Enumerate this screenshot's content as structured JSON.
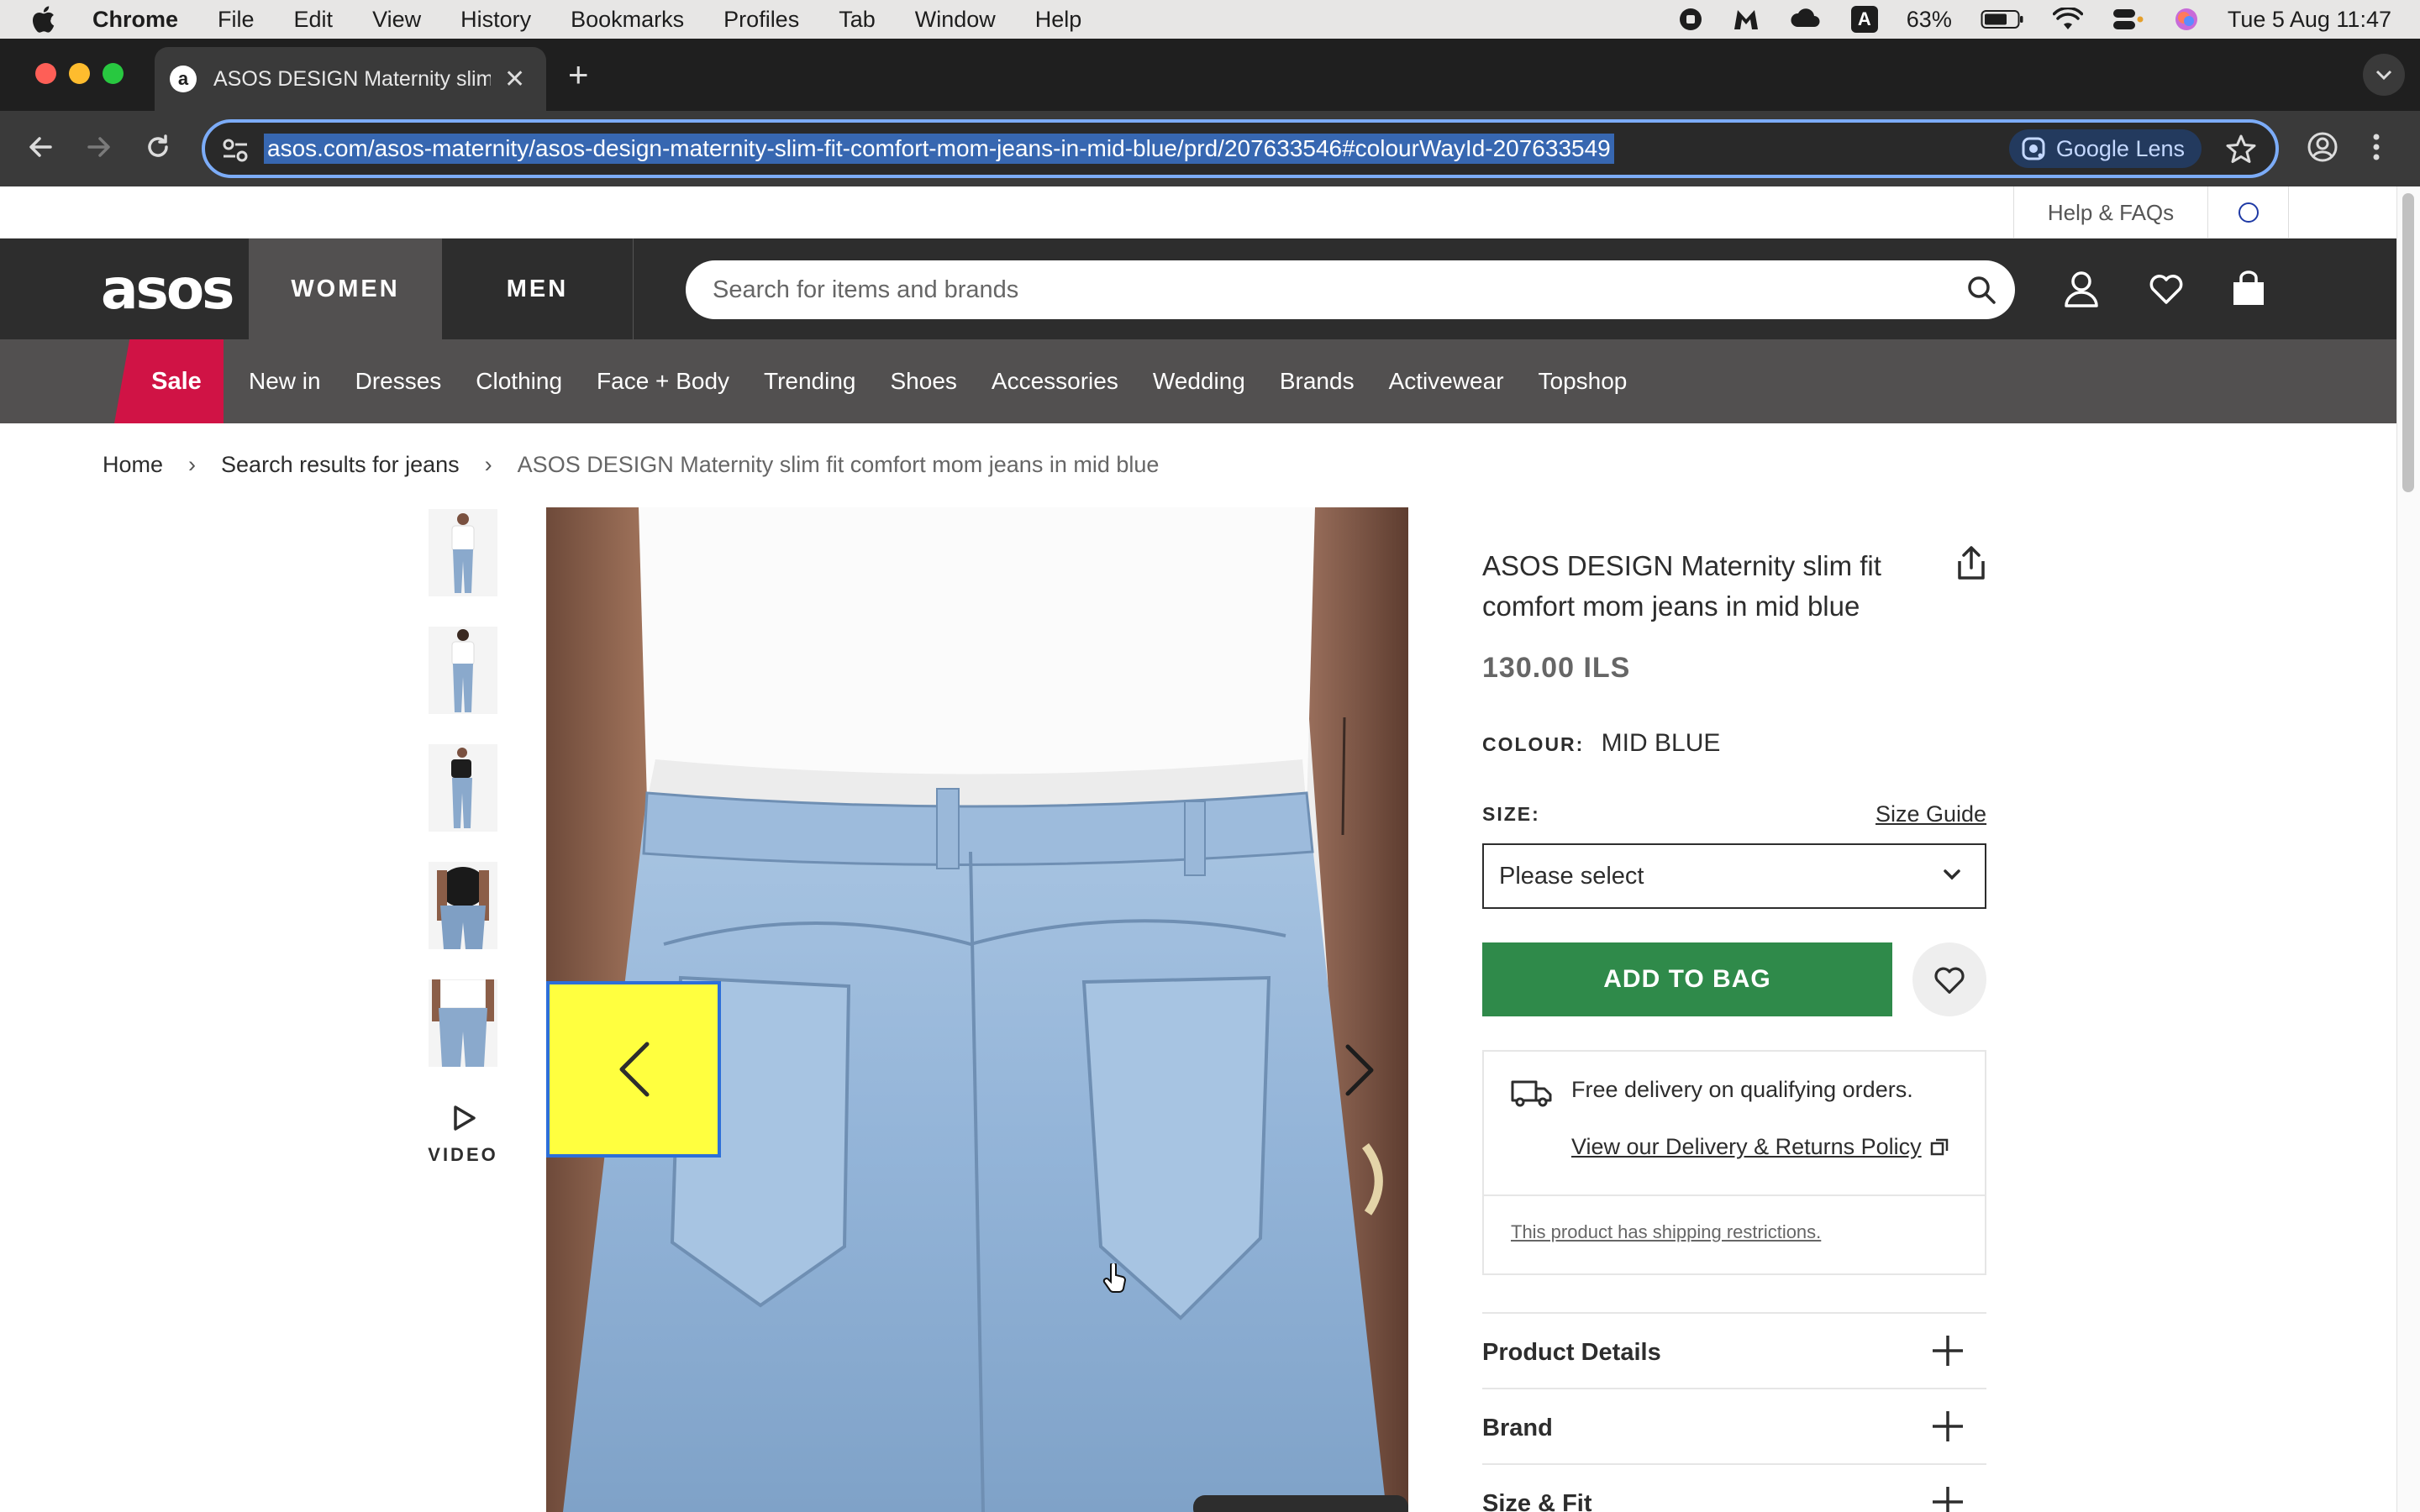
{
  "menubar": {
    "app": "Chrome",
    "items": [
      "File",
      "Edit",
      "View",
      "History",
      "Bookmarks",
      "Profiles",
      "Tab",
      "Window",
      "Help"
    ],
    "status_icons": [
      "record-icon",
      "malwarebytes-icon",
      "cloud-icon",
      "keyboard-input-icon",
      "battery-icon",
      "wifi-icon",
      "control-center-icon",
      "siri-icon"
    ],
    "input_source": "A",
    "battery": "63%",
    "datetime": "Tue 5 Aug  11:47"
  },
  "browser": {
    "tab_title": "ASOS DESIGN Maternity slim fit comfort mom jeans in mid blue",
    "url": "asos.com/asos-maternity/asos-design-maternity-slim-fit-comfort-mom-jeans-in-mid-blue/prd/207633546#colourWayId-207633549",
    "lens_label": "Google Lens"
  },
  "utility": {
    "help": "Help & FAQs"
  },
  "header": {
    "logo": "asos",
    "women": "WOMEN",
    "men": "MEN",
    "search_placeholder": "Search for items and brands"
  },
  "nav": {
    "sale": "Sale",
    "categories": [
      "New in",
      "Dresses",
      "Clothing",
      "Face + Body",
      "Trending",
      "Shoes",
      "Accessories",
      "Wedding",
      "Brands",
      "Activewear",
      "Topshop"
    ]
  },
  "breadcrumb": {
    "home": "Home",
    "search": "Search results for jeans",
    "current": "ASOS DESIGN Maternity slim fit comfort mom jeans in mid blue",
    "separator": "›"
  },
  "gallery": {
    "video_label": "VIDEO"
  },
  "product": {
    "title": "ASOS DESIGN Maternity slim fit comfort mom jeans in mid blue",
    "price": "130.00 ILS",
    "colour_label": "COLOUR:",
    "colour_value": "MID BLUE",
    "size_label": "SIZE:",
    "size_guide": "Size Guide",
    "size_placeholder": "Please select",
    "add_to_bag": "ADD TO BAG",
    "delivery_text": "Free delivery on qualifying orders.",
    "delivery_policy": "View our Delivery & Returns Policy",
    "shipping_restrictions": "This product has shipping restrictions.",
    "accordions": [
      "Product Details",
      "Brand",
      "Size & Fit"
    ]
  },
  "colors": {
    "brand_dark": "#2d2d2d",
    "nav_grey": "#525050",
    "sale_red": "#d01345",
    "add_green": "#2f8a4a",
    "highlight_yellow": "#ffff3f"
  }
}
